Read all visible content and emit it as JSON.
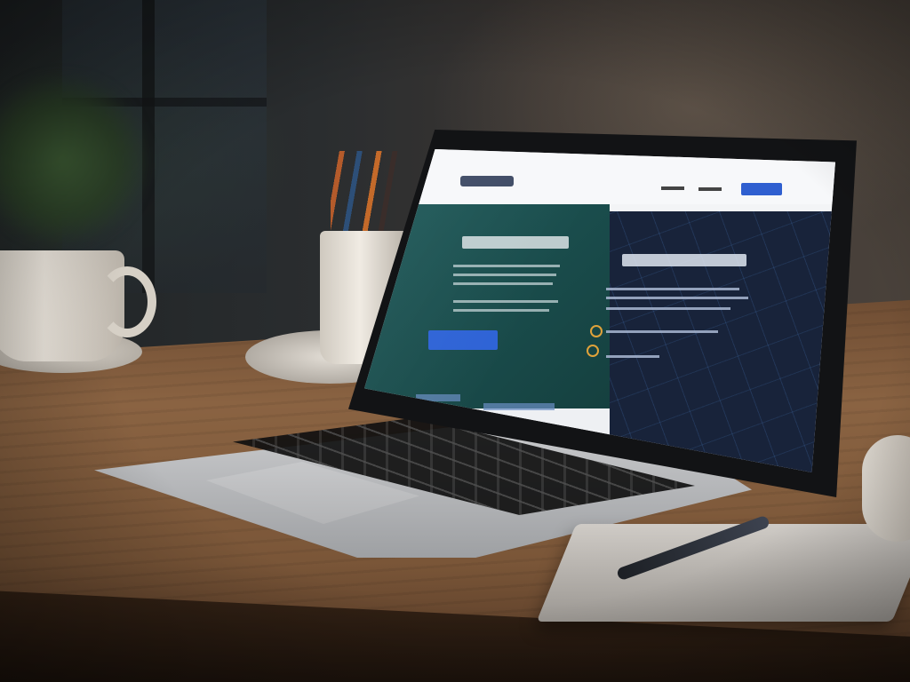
{
  "scene": {
    "subject": "laptop-on-wooden-desk",
    "colors": {
      "accent_blue": "#2f5fd0",
      "hero_teal": "#1f5a5a",
      "hero_navy": "#18233a",
      "table_wood": "#8a6342"
    }
  }
}
